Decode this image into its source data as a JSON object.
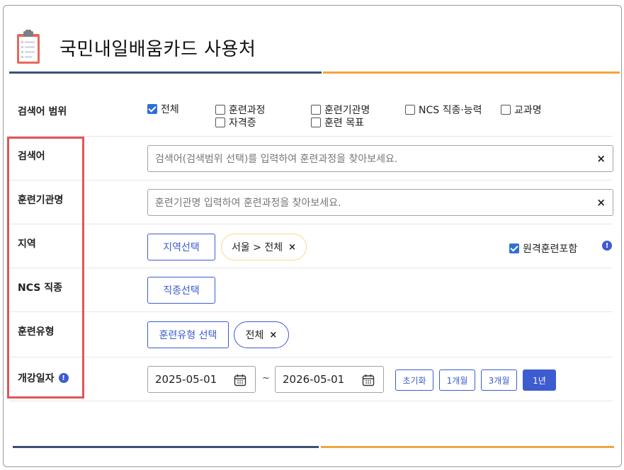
{
  "header": {
    "title": "국민내일배움카드 사용처",
    "icon": "clipboard-icon"
  },
  "search_scope": {
    "label": "검색어 범위",
    "options": [
      {
        "label": "전체",
        "checked": true
      },
      {
        "label": "훈련과정",
        "checked": false
      },
      {
        "label": "훈련기관명",
        "checked": false
      },
      {
        "label": "NCS 직종·능력",
        "checked": false
      },
      {
        "label": "교과명",
        "checked": false
      },
      {
        "label": "자격증",
        "checked": false
      },
      {
        "label": "훈련 목표",
        "checked": false
      }
    ]
  },
  "keyword": {
    "label": "검색어",
    "placeholder": "검색어(검색범위 선택)를 입력하여 훈련과정을 찾아보세요.",
    "clear": "×"
  },
  "institution": {
    "label": "훈련기관명",
    "placeholder": "훈련기관명 입력하여 훈련과정을 찾아보세요.",
    "clear": "×"
  },
  "region": {
    "label": "지역",
    "select_button": "지역선택",
    "chip": "서울 > 전체",
    "chip_remove": "×",
    "remote_label": "원격훈련포함",
    "remote_checked": true,
    "info": "!"
  },
  "ncs": {
    "label": "NCS 직종",
    "select_button": "직종선택"
  },
  "training_type": {
    "label": "훈련유형",
    "select_button": "훈련유형 선택",
    "chip": "전체",
    "chip_remove": "×"
  },
  "opening_date": {
    "label": "개강일자",
    "info": "!",
    "start": "2025-05-01",
    "separator": "~",
    "end": "2026-05-01",
    "buttons": [
      "초기화",
      "1개월",
      "3개월",
      "1년"
    ],
    "active_button": "1년"
  },
  "colors": {
    "accent_blue": "#3d5ccf",
    "navy_rule": "#3d4f78",
    "orange_rule": "#f2a53c",
    "highlight_red": "#e05656",
    "chip_border_yellow": "#f3dc8a",
    "checkbox_blue": "#2f6fd6"
  }
}
